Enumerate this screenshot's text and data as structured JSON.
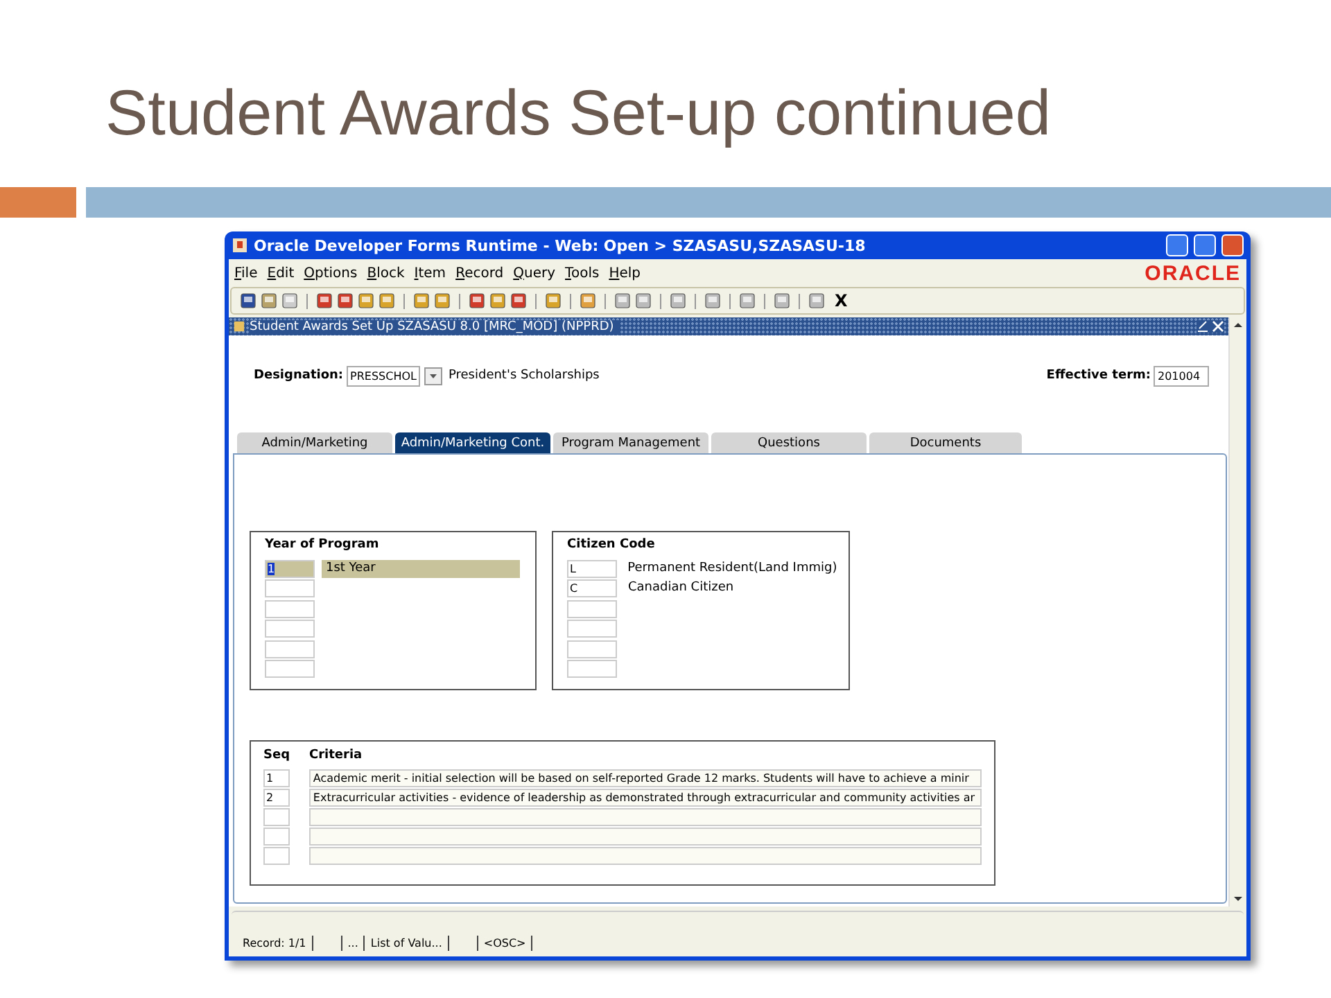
{
  "slide": {
    "title": "Student Awards Set-up continued"
  },
  "window": {
    "title": "Oracle Developer Forms Runtime - Web:  Open > SZASASU,SZASASU-18",
    "logo": "ORACLE"
  },
  "menu": [
    "File",
    "Edit",
    "Options",
    "Block",
    "Item",
    "Record",
    "Query",
    "Tools",
    "Help"
  ],
  "toolbar": {
    "exit_label": "X"
  },
  "form": {
    "title": "Student Awards Set Up  SZASASU  8.0  [MRC_MOD]  (NPPRD)",
    "designation": {
      "label": "Designation:",
      "value": "PRESSCHOL",
      "description": "President's Scholarships"
    },
    "effective_term": {
      "label": "Effective term:",
      "value": "201004"
    },
    "tabs": [
      {
        "label": "Admin/Marketing",
        "selected": false
      },
      {
        "label": "Admin/Marketing Cont.",
        "selected": true
      },
      {
        "label": "Program Management",
        "selected": false
      },
      {
        "label": "Questions",
        "selected": false
      },
      {
        "label": "Documents",
        "selected": false
      }
    ],
    "year_of_program": {
      "title": "Year of Program",
      "rows": [
        {
          "kind": "filled",
          "code": "1",
          "description": "1st Year",
          "selected": true
        },
        {
          "kind": "blank"
        },
        {
          "kind": "blank"
        },
        {
          "kind": "blank"
        },
        {
          "kind": "blank"
        },
        {
          "kind": "blank"
        }
      ]
    },
    "citizen_code": {
      "title": "Citizen Code",
      "rows": [
        {
          "kind": "filled",
          "code": "L",
          "description": "Permanent Resident(Land Immig)",
          "selected": false
        },
        {
          "kind": "filled",
          "code": "C",
          "description": "Canadian Citizen",
          "selected": false
        },
        {
          "kind": "blank"
        },
        {
          "kind": "blank"
        },
        {
          "kind": "blank"
        },
        {
          "kind": "blank"
        }
      ]
    },
    "criteria": {
      "seq_header": "Seq",
      "criteria_header": "Criteria",
      "rows": [
        {
          "kind": "filled",
          "seq": "1",
          "text": "Academic merit - initial selection will be based on self-reported Grade 12 marks. Students will have to achieve a minir"
        },
        {
          "kind": "filled",
          "seq": "2",
          "text": "Extracurricular activities - evidence of leadership as demonstrated through extracurricular and community activities ar"
        },
        {
          "kind": "blank"
        },
        {
          "kind": "blank"
        },
        {
          "kind": "blank"
        }
      ]
    }
  },
  "status_bar": [
    {
      "kind": "text",
      "text": "Record: 1/1"
    },
    {
      "kind": "blank"
    },
    {
      "kind": "text",
      "text": "..."
    },
    {
      "kind": "text",
      "text": "List of Valu..."
    },
    {
      "kind": "blank"
    },
    {
      "kind": "text",
      "text": "<OSC>"
    }
  ]
}
